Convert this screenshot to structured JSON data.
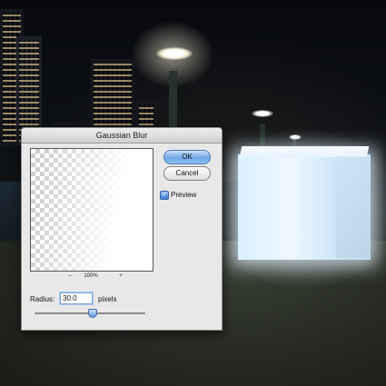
{
  "dialog": {
    "title": "Gaussian Blur",
    "ok_label": "OK",
    "cancel_label": "Cancel",
    "preview_label": "Preview",
    "preview_checked": true,
    "zoom_out_label": "–",
    "zoom_level": "100%",
    "zoom_in_label": "+",
    "radius_label": "Radius:",
    "radius_value": "30.0",
    "radius_unit": "pixels",
    "slider_fraction": 0.52
  }
}
